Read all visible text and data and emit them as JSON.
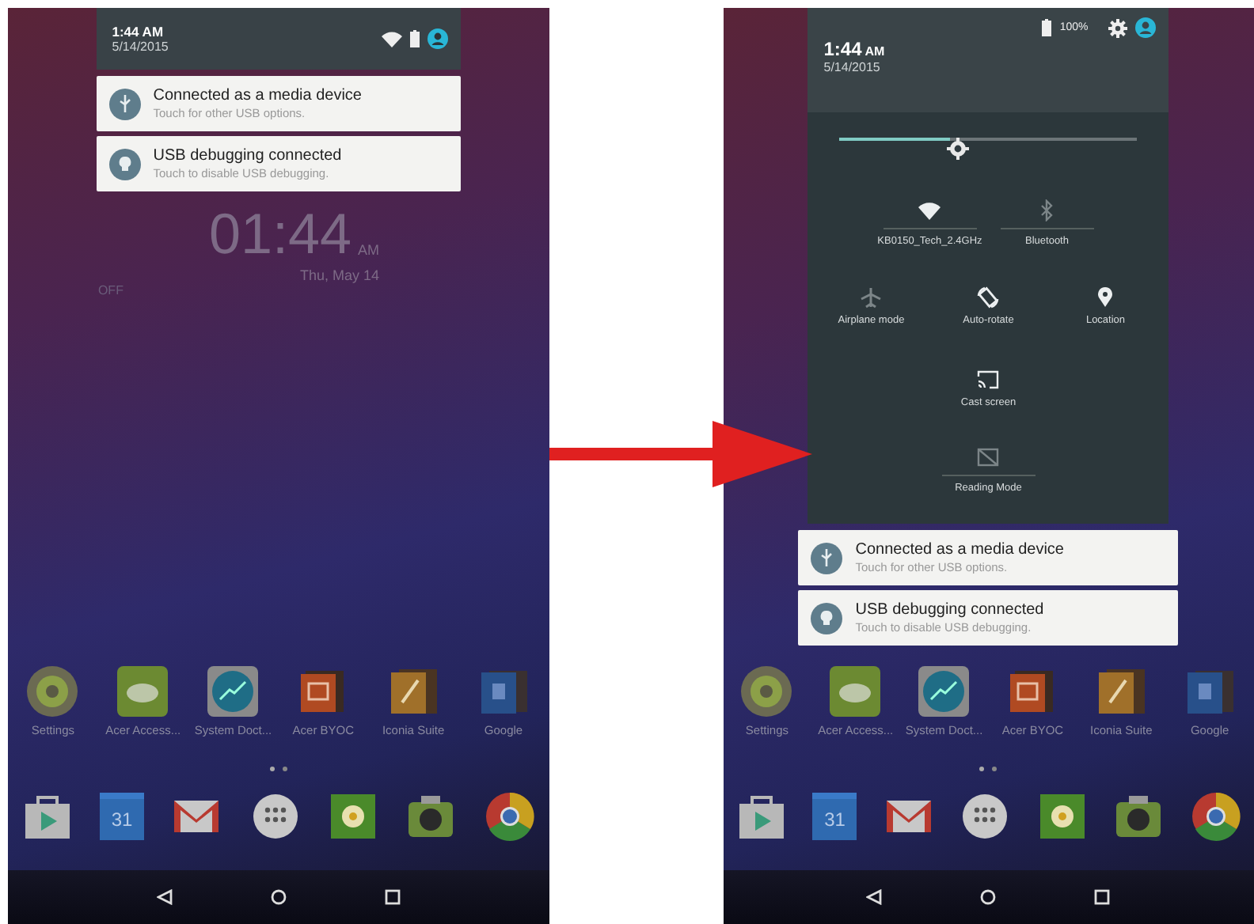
{
  "screens": [
    {
      "kind": "notification_shade",
      "header": {
        "time": "1:44",
        "meridiem": "AM",
        "date": "5/14/2015"
      },
      "notifications": [
        {
          "kind": "usb",
          "title": "Connected as a media device",
          "text": "Touch for other USB options."
        },
        {
          "kind": "debug",
          "title": "USB debugging connected",
          "text": "Touch to disable USB debugging."
        }
      ],
      "lock_clock": {
        "time": "01:44",
        "meridiem": "AM",
        "date": "Thu, May 14",
        "status": "OFF"
      },
      "apps": [
        {
          "kind": "settings",
          "label": "Settings"
        },
        {
          "kind": "cloud",
          "label": "Acer Access..."
        },
        {
          "kind": "chart",
          "label": "System Doct..."
        },
        {
          "kind": "slides",
          "label": "Acer BYOC"
        },
        {
          "kind": "suite",
          "label": "Iconia Suite"
        },
        {
          "kind": "google",
          "label": "Google"
        }
      ],
      "dock": [
        {
          "kind": "store"
        },
        {
          "kind": "calendar",
          "text": "31"
        },
        {
          "kind": "mail"
        },
        {
          "kind": "launcher"
        },
        {
          "kind": "gallery"
        },
        {
          "kind": "camera"
        },
        {
          "kind": "browser"
        }
      ]
    },
    {
      "kind": "quick_settings",
      "header": {
        "time": "1:44",
        "meridiem": "AM",
        "date": "5/14/2015",
        "battery": "100%"
      },
      "quick_settings": {
        "brightness": {
          "level": 0.37
        },
        "rows": [
          {
            "tiles": [
              {
                "kind": "wifi",
                "label": "KB0150_Tech_2.4GHz",
                "on": true,
                "dual": true
              },
              {
                "kind": "bluetooth",
                "label": "Bluetooth",
                "on": false,
                "dual": true
              }
            ]
          },
          {
            "tiles": [
              {
                "kind": "airplane",
                "label": "Airplane mode",
                "on": false,
                "dual": false
              },
              {
                "kind": "rotate",
                "label": "Auto-rotate",
                "on": true,
                "dual": false
              },
              {
                "kind": "location",
                "label": "Location",
                "on": true,
                "dual": false
              }
            ]
          },
          {
            "tiles": [
              {
                "kind": "cast",
                "label": "Cast screen",
                "on": true,
                "dual": false
              }
            ]
          },
          {
            "tiles": [
              {
                "kind": "reading",
                "label": "Reading Mode",
                "on": false,
                "dual": true
              }
            ]
          }
        ]
      },
      "notifications": [
        {
          "kind": "usb",
          "title": "Connected as a media device",
          "text": "Touch for other USB options."
        },
        {
          "kind": "debug",
          "title": "USB debugging connected",
          "text": "Touch to disable USB debugging."
        }
      ],
      "apps": [
        {
          "kind": "settings",
          "label": "Settings"
        },
        {
          "kind": "cloud",
          "label": "Acer Access..."
        },
        {
          "kind": "chart",
          "label": "System Doct..."
        },
        {
          "kind": "slides",
          "label": "Acer BYOC"
        },
        {
          "kind": "suite",
          "label": "Iconia Suite"
        },
        {
          "kind": "google",
          "label": "Google"
        }
      ],
      "dock": [
        {
          "kind": "store"
        },
        {
          "kind": "calendar",
          "text": "31"
        },
        {
          "kind": "mail"
        },
        {
          "kind": "launcher"
        },
        {
          "kind": "gallery"
        },
        {
          "kind": "camera"
        },
        {
          "kind": "browser"
        }
      ]
    }
  ]
}
